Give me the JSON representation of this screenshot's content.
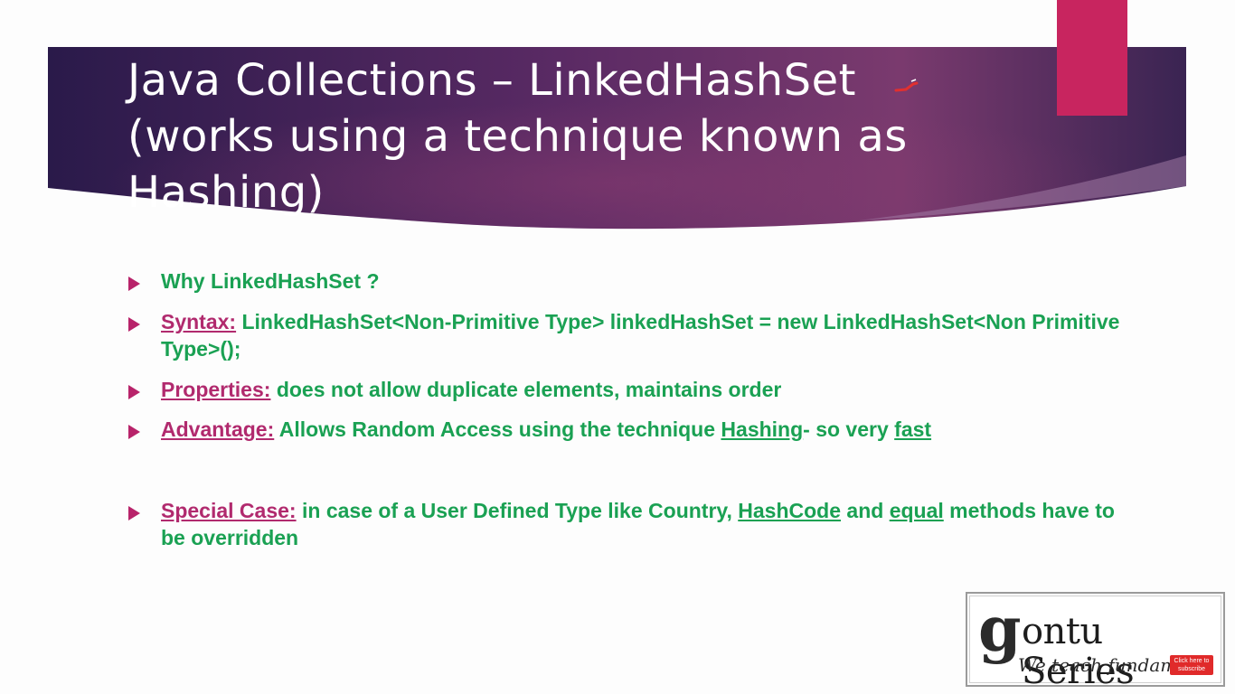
{
  "header": {
    "title": "Java Collections – LinkedHashSet (works using a technique known as Hashing)",
    "accent_color": "#c8255f",
    "gradient_colors": [
      "#2a1a4a",
      "#5a2a64",
      "#7a3a6e"
    ]
  },
  "bullets": [
    {
      "text": "Why LinkedHashSet ?"
    },
    {
      "label": "Syntax:",
      "text": " LinkedHashSet<Non-Primitive Type> linkedHashSet = new LinkedHashSet<Non Primitive Type>();"
    },
    {
      "label": "Properties:",
      "text": " does not allow duplicate elements, maintains order"
    },
    {
      "label": "Advantage:",
      "pre": " Allows Random Access using the technique ",
      "u1": "Hashing",
      "mid": "- so very ",
      "u2": "fast"
    },
    {
      "label": "Special Case:",
      "pre": " in case of a User Defined Type like Country, ",
      "u1": "HashCode",
      "mid": " and ",
      "u2": "equal",
      "post": " methods have to be overridden"
    }
  ],
  "logo": {
    "g": "g",
    "name": "ontu Series",
    "tagline": "We teach fundamen",
    "badge": "Click here to subscribe"
  },
  "colors": {
    "bullet_text": "#1aa153",
    "label": "#b12a6e",
    "arrow": "#b8236a"
  }
}
